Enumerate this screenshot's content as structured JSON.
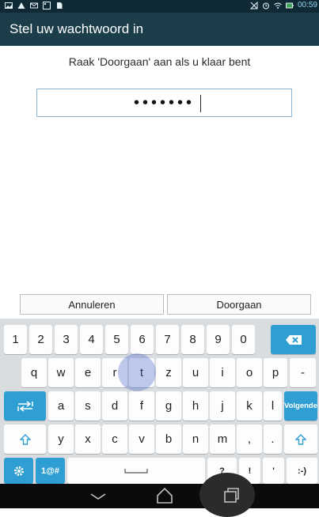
{
  "status_bar": {
    "time": "00:59",
    "left_icons": [
      "picture-icon",
      "warning-icon",
      "email-icon",
      "image-icon",
      "document-icon"
    ],
    "right_icons": [
      "no-signal-icon",
      "alarm-icon",
      "wifi-icon",
      "battery-icon"
    ]
  },
  "app_bar": {
    "title": "Stel uw wachtwoord in"
  },
  "instruction": "Raak 'Doorgaan' aan als u klaar bent",
  "password_field": {
    "value": "•••••••",
    "entered_length": 7
  },
  "buttons": {
    "cancel": "Annuleren",
    "continue": "Doorgaan"
  },
  "keyboard": {
    "row1": [
      "1",
      "2",
      "3",
      "4",
      "5",
      "6",
      "7",
      "8",
      "9",
      "0"
    ],
    "row2": [
      "q",
      "w",
      "e",
      "r",
      "t",
      "z",
      "u",
      "i",
      "o",
      "p",
      "-"
    ],
    "row3": [
      "a",
      "s",
      "d",
      "f",
      "g",
      "h",
      "j",
      "k",
      "l"
    ],
    "row4": [
      "y",
      "x",
      "c",
      "v",
      "b",
      "n",
      "m",
      ",",
      "."
    ],
    "row5": [
      "?",
      "!",
      "'",
      ":-)"
    ],
    "enter_label": "Volgende",
    "symbols_label": "1@#",
    "pressed_key": "t"
  },
  "colors": {
    "status_bar": "#0f2a35",
    "app_bar": "#1c3e4a",
    "field_border": "#8ab4d8",
    "keyboard_bg": "#d9dde0",
    "key_accent": "#2f9fd3",
    "nav_bar": "#0b0b0b"
  }
}
